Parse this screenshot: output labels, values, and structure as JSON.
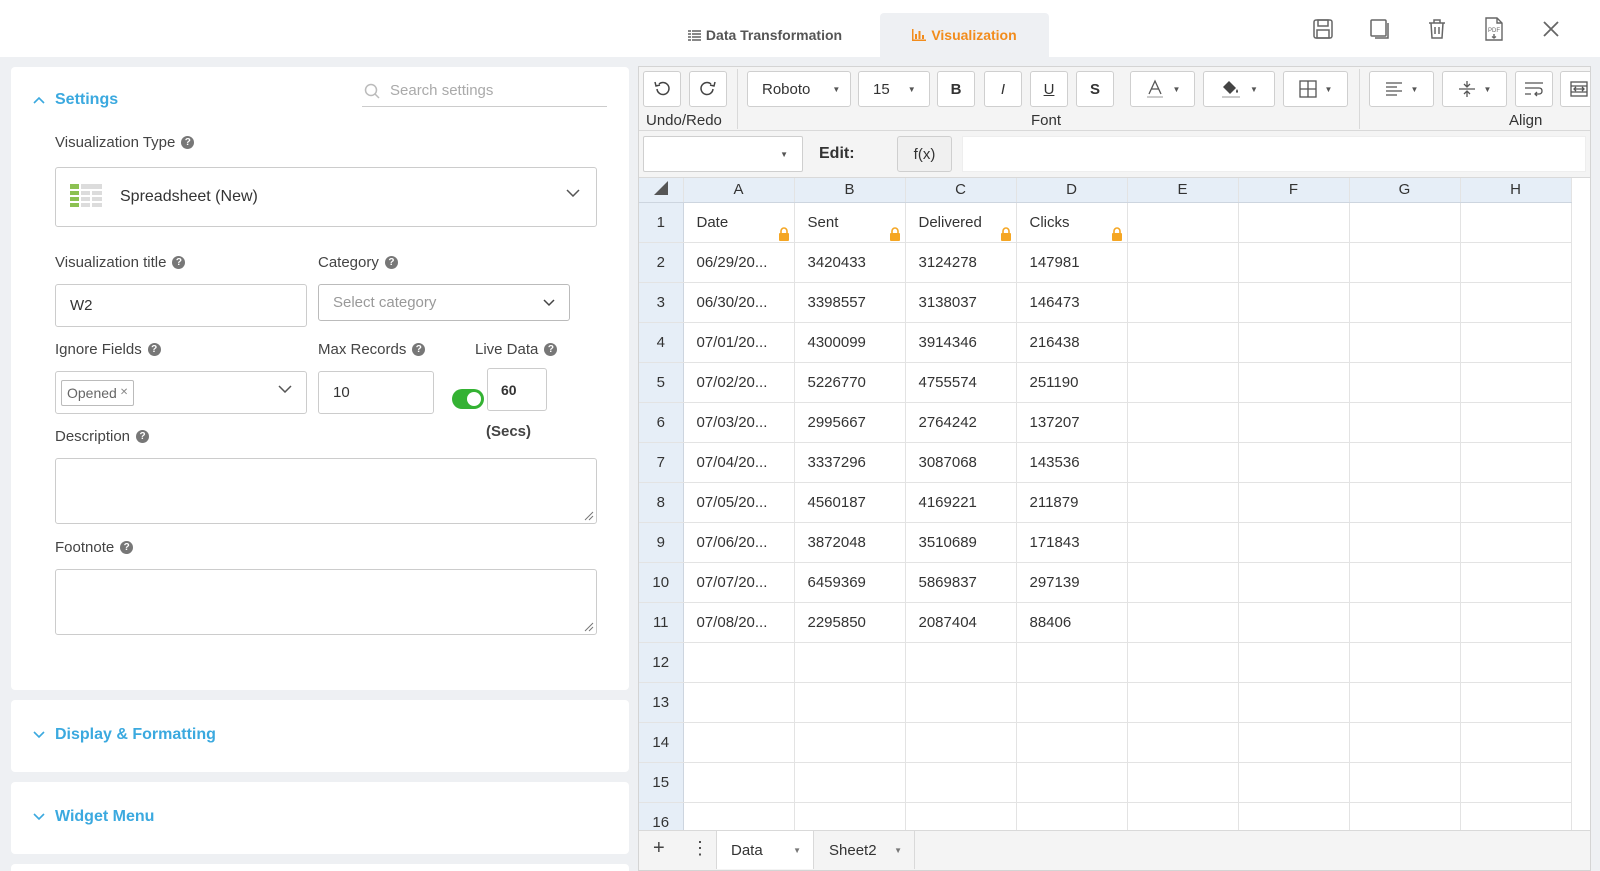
{
  "tabs": {
    "data_transformation": "Data Transformation",
    "visualization": "Visualization"
  },
  "toolbar_icons": [
    "save-icon",
    "duplicate-icon",
    "trash-icon",
    "pdf-export-icon",
    "close-icon"
  ],
  "settings": {
    "section_title": "Settings",
    "search_placeholder": "Search settings",
    "visualization_type_label": "Visualization Type",
    "visualization_type_value": "Spreadsheet (New)",
    "visualization_title_label": "Visualization title",
    "visualization_title_value": "W2",
    "category_label": "Category",
    "category_placeholder": "Select category",
    "ignore_fields_label": "Ignore Fields",
    "ignore_fields_chip": "Opened",
    "max_records_label": "Max Records",
    "max_records_value": "10",
    "live_data_label": "Live Data",
    "live_data_enabled": true,
    "live_data_interval": "60",
    "live_data_unit": "(Secs)",
    "description_label": "Description",
    "footnote_label": "Footnote"
  },
  "sections": {
    "display_formatting": "Display & Formatting",
    "widget_menu": "Widget Menu"
  },
  "ribbon": {
    "undo_redo_label": "Undo/Redo",
    "font_name": "Roboto",
    "font_size": "15",
    "bold": "B",
    "italic": "I",
    "underline": "U",
    "strike": "S",
    "font_group_label": "Font",
    "align_group_label": "Align"
  },
  "formula_bar": {
    "edit_label": "Edit:",
    "fx_label": "f(x)"
  },
  "spreadsheet": {
    "columns": [
      "A",
      "B",
      "C",
      "D",
      "E",
      "F",
      "G",
      "H"
    ],
    "rows": [
      [
        "1",
        "Date",
        "Sent",
        "Delivered",
        "Clicks"
      ],
      [
        "2",
        "06/29/20...",
        "3420433",
        "3124278",
        "147981"
      ],
      [
        "3",
        "06/30/20...",
        "3398557",
        "3138037",
        "146473"
      ],
      [
        "4",
        "07/01/20...",
        "4300099",
        "3914346",
        "216438"
      ],
      [
        "5",
        "07/02/20...",
        "5226770",
        "4755574",
        "251190"
      ],
      [
        "6",
        "07/03/20...",
        "2995667",
        "2764242",
        "137207"
      ],
      [
        "7",
        "07/04/20...",
        "3337296",
        "3087068",
        "143536"
      ],
      [
        "8",
        "07/05/20...",
        "4560187",
        "4169221",
        "211879"
      ],
      [
        "9",
        "07/06/20...",
        "3872048",
        "3510689",
        "171843"
      ],
      [
        "10",
        "07/07/20...",
        "6459369",
        "5869837",
        "297139"
      ],
      [
        "11",
        "07/08/20...",
        "2295850",
        "2087404",
        "88406"
      ],
      [
        "12",
        "",
        "",
        "",
        ""
      ],
      [
        "13",
        "",
        "",
        "",
        ""
      ],
      [
        "14",
        "",
        "",
        "",
        ""
      ],
      [
        "15",
        "",
        "",
        "",
        ""
      ],
      [
        "16",
        "",
        "",
        "",
        ""
      ]
    ],
    "sheet_tabs": [
      "Data",
      "Sheet2"
    ]
  }
}
